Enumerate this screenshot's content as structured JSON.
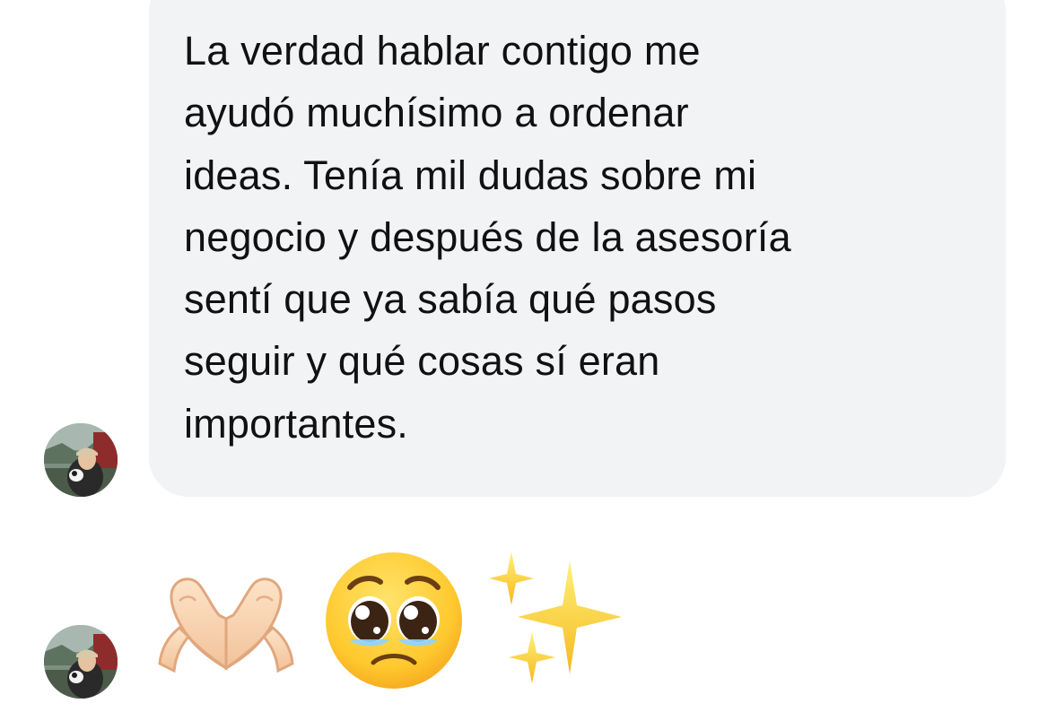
{
  "conversation": {
    "message_1": {
      "text": "La verdad hablar contigo me\nayudó muchísimo a ordenar\nideas. Tenía mil dudas sobre mi\nnegocio y después de la asesoría\nsentí que ya sabía qué pasos\nseguir y qué cosas sí eran\nimportantes."
    },
    "message_2": {
      "emojis": [
        "heart-hands",
        "pleading-face",
        "sparkles"
      ]
    }
  },
  "colors": {
    "bubble_background": "#f1f3f5",
    "text": "#111111",
    "page_background": "#ffffff"
  }
}
